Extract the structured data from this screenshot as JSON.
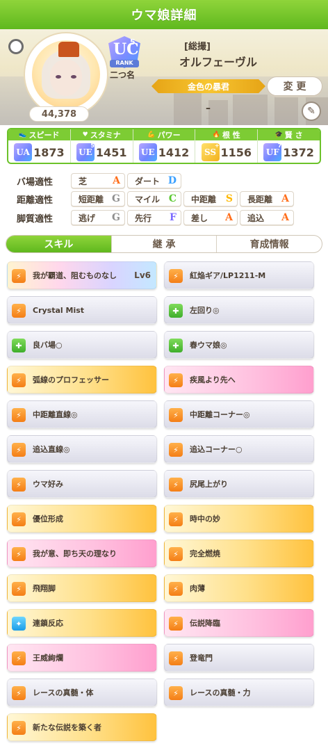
{
  "header": {
    "title": "ウマ娘詳細"
  },
  "profile": {
    "power_value": "44,378",
    "rank_letters": "UC",
    "rank_number": "5",
    "rank_label": "RANK",
    "epithet_label": "二つ名",
    "title_bracket": "[総撮]",
    "character_name": "オルフェーヴル",
    "epithet": "金色の暴君",
    "change_label": "変 更",
    "dash": "–"
  },
  "stats": [
    {
      "label": "スピード",
      "icon": "shoe-icon",
      "grade": "UA",
      "grade_num": "",
      "value": "1873"
    },
    {
      "label": "スタミナ",
      "icon": "heart-icon",
      "grade": "UE",
      "grade_num": "5",
      "value": "1451"
    },
    {
      "label": "パワー",
      "icon": "muscle-icon",
      "grade": "UE",
      "grade_num": "",
      "value": "1412"
    },
    {
      "label": "根 性",
      "icon": "flame-icon",
      "grade": "SS",
      "grade_num": "+",
      "value": "1156"
    },
    {
      "label": "賢 さ",
      "icon": "graduation-cap-icon",
      "grade": "UF",
      "grade_num": "7",
      "value": "1372"
    }
  ],
  "aptitudes": {
    "track": {
      "label": "バ場適性",
      "items": [
        {
          "name": "芝",
          "grade": "A"
        },
        {
          "name": "ダート",
          "grade": "D"
        }
      ]
    },
    "distance": {
      "label": "距離適性",
      "items": [
        {
          "name": "短距離",
          "grade": "G"
        },
        {
          "name": "マイル",
          "grade": "C"
        },
        {
          "name": "中距離",
          "grade": "S"
        },
        {
          "name": "長距離",
          "grade": "A"
        }
      ]
    },
    "style": {
      "label": "脚質適性",
      "items": [
        {
          "name": "逃げ",
          "grade": "G"
        },
        {
          "name": "先行",
          "grade": "F"
        },
        {
          "name": "差し",
          "grade": "A"
        },
        {
          "name": "追込",
          "grade": "A"
        }
      ]
    }
  },
  "tabs": [
    {
      "label": "スキル"
    },
    {
      "label": "継 承"
    },
    {
      "label": "育成情報"
    }
  ],
  "skills": [
    {
      "name": "我が覇道、阻むものなし",
      "level": "Lv6",
      "bg": "rainbow",
      "icon": "orange"
    },
    {
      "name": "紅焔ギア/LP1211-M",
      "level": "",
      "bg": "white",
      "icon": "orange"
    },
    {
      "name": "Crystal Mist",
      "level": "",
      "bg": "white",
      "icon": "orange"
    },
    {
      "name": "左回り◎",
      "level": "",
      "bg": "white",
      "icon": "green"
    },
    {
      "name": "良バ場○",
      "level": "",
      "bg": "white",
      "icon": "green"
    },
    {
      "name": "春ウマ娘◎",
      "level": "",
      "bg": "white",
      "icon": "green"
    },
    {
      "name": "弧線のプロフェッサー",
      "level": "",
      "bg": "gold",
      "icon": "orange"
    },
    {
      "name": "疾風より先へ",
      "level": "",
      "bg": "pink",
      "icon": "orange"
    },
    {
      "name": "中距離直線◎",
      "level": "",
      "bg": "white",
      "icon": "orange"
    },
    {
      "name": "中距離コーナー◎",
      "level": "",
      "bg": "white",
      "icon": "orange"
    },
    {
      "name": "追込直線◎",
      "level": "",
      "bg": "white",
      "icon": "orange"
    },
    {
      "name": "追込コーナー○",
      "level": "",
      "bg": "white",
      "icon": "orange"
    },
    {
      "name": "ウマ好み",
      "level": "",
      "bg": "white",
      "icon": "orange"
    },
    {
      "name": "尻尾上がり",
      "level": "",
      "bg": "white",
      "icon": "orange"
    },
    {
      "name": "優位形成",
      "level": "",
      "bg": "gold",
      "icon": "orange"
    },
    {
      "name": "時中の妙",
      "level": "",
      "bg": "gold",
      "icon": "orange"
    },
    {
      "name": "我が意、即ち天の理なり",
      "level": "",
      "bg": "pink",
      "icon": "orange"
    },
    {
      "name": "完全燃焼",
      "level": "",
      "bg": "gold",
      "icon": "orange"
    },
    {
      "name": "飛翔脚",
      "level": "",
      "bg": "gold",
      "icon": "orange"
    },
    {
      "name": "肉薄",
      "level": "",
      "bg": "gold",
      "icon": "orange"
    },
    {
      "name": "連鎖反応",
      "level": "",
      "bg": "gold",
      "icon": "blue"
    },
    {
      "name": "伝説降臨",
      "level": "",
      "bg": "pink",
      "icon": "orange"
    },
    {
      "name": "王威絢爛",
      "level": "",
      "bg": "pink",
      "icon": "orange"
    },
    {
      "name": "登竜門",
      "level": "",
      "bg": "white",
      "icon": "orange"
    },
    {
      "name": "レースの真髄・体",
      "level": "",
      "bg": "white",
      "icon": "orange"
    },
    {
      "name": "レースの真髄・力",
      "level": "",
      "bg": "white",
      "icon": "orange"
    },
    {
      "name": "新たな伝説を築く者",
      "level": "",
      "bg": "gold",
      "icon": "orange"
    }
  ]
}
